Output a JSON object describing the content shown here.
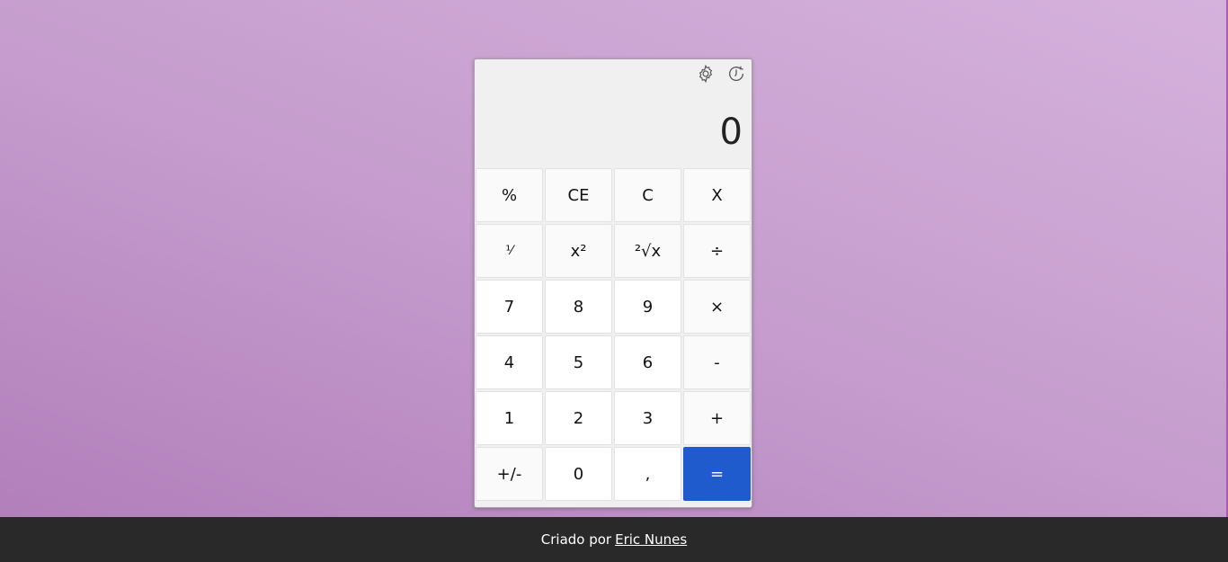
{
  "calculator": {
    "display_value": "0",
    "icons": {
      "settings": "gear-icon",
      "history": "history-icon"
    },
    "keys": [
      {
        "label": "%",
        "name": "percent-button",
        "type": "fn"
      },
      {
        "label": "CE",
        "name": "clear-entry-button",
        "type": "fn"
      },
      {
        "label": "C",
        "name": "clear-button",
        "type": "fn"
      },
      {
        "label": "X",
        "name": "backspace-button",
        "type": "fn"
      },
      {
        "label": "¹⁄",
        "name": "reciprocal-button",
        "type": "fn-small"
      },
      {
        "label": "x²",
        "name": "square-button",
        "type": "fn"
      },
      {
        "label": "²√x",
        "name": "square-root-button",
        "type": "fn"
      },
      {
        "label": "÷",
        "name": "divide-button",
        "type": "fn"
      },
      {
        "label": "7",
        "name": "digit-7-button",
        "type": "num"
      },
      {
        "label": "8",
        "name": "digit-8-button",
        "type": "num"
      },
      {
        "label": "9",
        "name": "digit-9-button",
        "type": "num"
      },
      {
        "label": "×",
        "name": "multiply-button",
        "type": "fn"
      },
      {
        "label": "4",
        "name": "digit-4-button",
        "type": "num"
      },
      {
        "label": "5",
        "name": "digit-5-button",
        "type": "num"
      },
      {
        "label": "6",
        "name": "digit-6-button",
        "type": "num"
      },
      {
        "label": "-",
        "name": "subtract-button",
        "type": "fn"
      },
      {
        "label": "1",
        "name": "digit-1-button",
        "type": "num"
      },
      {
        "label": "2",
        "name": "digit-2-button",
        "type": "num"
      },
      {
        "label": "3",
        "name": "digit-3-button",
        "type": "num"
      },
      {
        "label": "+",
        "name": "add-button",
        "type": "fn"
      },
      {
        "label": "+/-",
        "name": "negate-button",
        "type": "fn"
      },
      {
        "label": "0",
        "name": "digit-0-button",
        "type": "num"
      },
      {
        "label": ",",
        "name": "decimal-button",
        "type": "num"
      },
      {
        "label": "=",
        "name": "equals-button",
        "type": "equals"
      }
    ]
  },
  "footer": {
    "prefix": "Criado por",
    "author": "Eric Nunes"
  },
  "colors": {
    "accent": "#1f5bcc",
    "footer_bg": "#292929"
  }
}
